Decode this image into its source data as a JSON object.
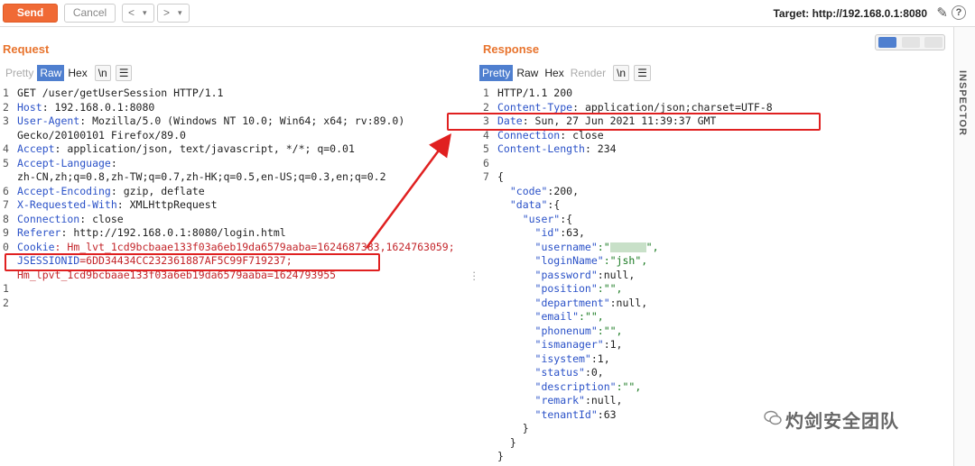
{
  "toolbar": {
    "send_label": "Send",
    "cancel_label": "Cancel",
    "target_label": "Target: http://192.168.0.1:8080"
  },
  "request": {
    "title": "Request",
    "tabs": [
      "Pretty",
      "Raw",
      "Hex",
      "\\n"
    ],
    "active_tab": "Raw",
    "line_numbers": [
      "1",
      "2",
      "3",
      "",
      "4",
      "5",
      "",
      "6",
      "7",
      "8",
      "9",
      "0",
      "",
      "",
      "1",
      "2"
    ],
    "lines": [
      {
        "key": "GET /user/getUserSession HTTP/1.1",
        "val": ""
      },
      {
        "key": "Host",
        "val": ": 192.168.0.1:8080"
      },
      {
        "key": "User-Agent",
        "val": ": Mozilla/5.0 (Windows NT 10.0; Win64; x64; rv:89.0)"
      },
      {
        "key": "",
        "val": "Gecko/20100101 Firefox/89.0"
      },
      {
        "key": "Accept",
        "val": ": application/json, text/javascript, */*; q=0.01"
      },
      {
        "key": "Accept-Language",
        "val": ":"
      },
      {
        "key": "",
        "val": "zh-CN,zh;q=0.8,zh-TW;q=0.7,zh-HK;q=0.5,en-US;q=0.3,en;q=0.2"
      },
      {
        "key": "Accept-Encoding",
        "val": ": gzip, deflate"
      },
      {
        "key": "X-Requested-With",
        "val": ": XMLHttpRequest"
      },
      {
        "key": "Connection",
        "val": ": close"
      },
      {
        "key": "Referer",
        "val": ": http://192.168.0.1:8080/login.html"
      },
      {
        "key": "Cookie",
        "val": ": Hm_lvt_1cd9bcbaae133f03a6eb19da6579aaba=1624687383,1624763059;"
      },
      {
        "key": "JSESSIONID",
        "val": "=6DD34434CC232361887AF5C99F719237;"
      },
      {
        "key": "",
        "val": "Hm_lpvt_1cd9bcbaae133f03a6eb19da6579aaba=1624793955"
      },
      {
        "key": "",
        "val": ""
      },
      {
        "key": "",
        "val": ""
      }
    ]
  },
  "response": {
    "title": "Response",
    "tabs": [
      "Pretty",
      "Raw",
      "Hex",
      "Render",
      "\\n"
    ],
    "active_tab": "Pretty",
    "line_numbers": [
      "1",
      "2",
      "3",
      "4",
      "5",
      "6",
      "7",
      "",
      "",
      "",
      "",
      "",
      "",
      "",
      "",
      "",
      "",
      "",
      "",
      "",
      "",
      "",
      "",
      "",
      "",
      "",
      ""
    ],
    "lines": [
      {
        "key": "HTTP/1.1 200",
        "val": ""
      },
      {
        "key": "Content-Type",
        "val": ": application/json;charset=UTF-8"
      },
      {
        "key": "Date",
        "val": ": Sun, 27 Jun 2021 11:39:37 GMT"
      },
      {
        "key": "Connection",
        "val": ": close"
      },
      {
        "key": "Content-Length",
        "val": ": 234"
      },
      {
        "key": "",
        "val": ""
      },
      {
        "key": "",
        "val": "{"
      },
      {
        "key": "  \"code\"",
        "val": ":200,"
      },
      {
        "key": "  \"data\"",
        "val": ":{"
      },
      {
        "key": "    \"user\"",
        "val": ":{"
      },
      {
        "key": "      \"id\"",
        "val": ":63,"
      },
      {
        "key": "      \"username\"",
        "val": ":\""
      },
      {
        "key": "      \"loginName\"",
        "val": ":\"jsh\","
      },
      {
        "key": "      \"password\"",
        "val": ":null,"
      },
      {
        "key": "      \"position\"",
        "val": ":\"\","
      },
      {
        "key": "      \"department\"",
        "val": ":null,"
      },
      {
        "key": "      \"email\"",
        "val": ":\"\","
      },
      {
        "key": "      \"phonenum\"",
        "val": ":\"\","
      },
      {
        "key": "      \"ismanager\"",
        "val": ":1,"
      },
      {
        "key": "      \"isystem\"",
        "val": ":1,"
      },
      {
        "key": "      \"status\"",
        "val": ":0,"
      },
      {
        "key": "      \"description\"",
        "val": ":\"\","
      },
      {
        "key": "      \"remark\"",
        "val": ":null,"
      },
      {
        "key": "      \"tenantId\"",
        "val": ":63"
      },
      {
        "key": "",
        "val": "    }"
      },
      {
        "key": "",
        "val": "  }"
      },
      {
        "key": "",
        "val": "}"
      }
    ]
  },
  "inspector_label": "INSPECTOR",
  "watermark_text": "灼剑安全团队",
  "colors": {
    "accent": "#f06a35",
    "title": "#e8742e",
    "active_tab": "#4f7fcf",
    "highlight": "#e02020"
  }
}
